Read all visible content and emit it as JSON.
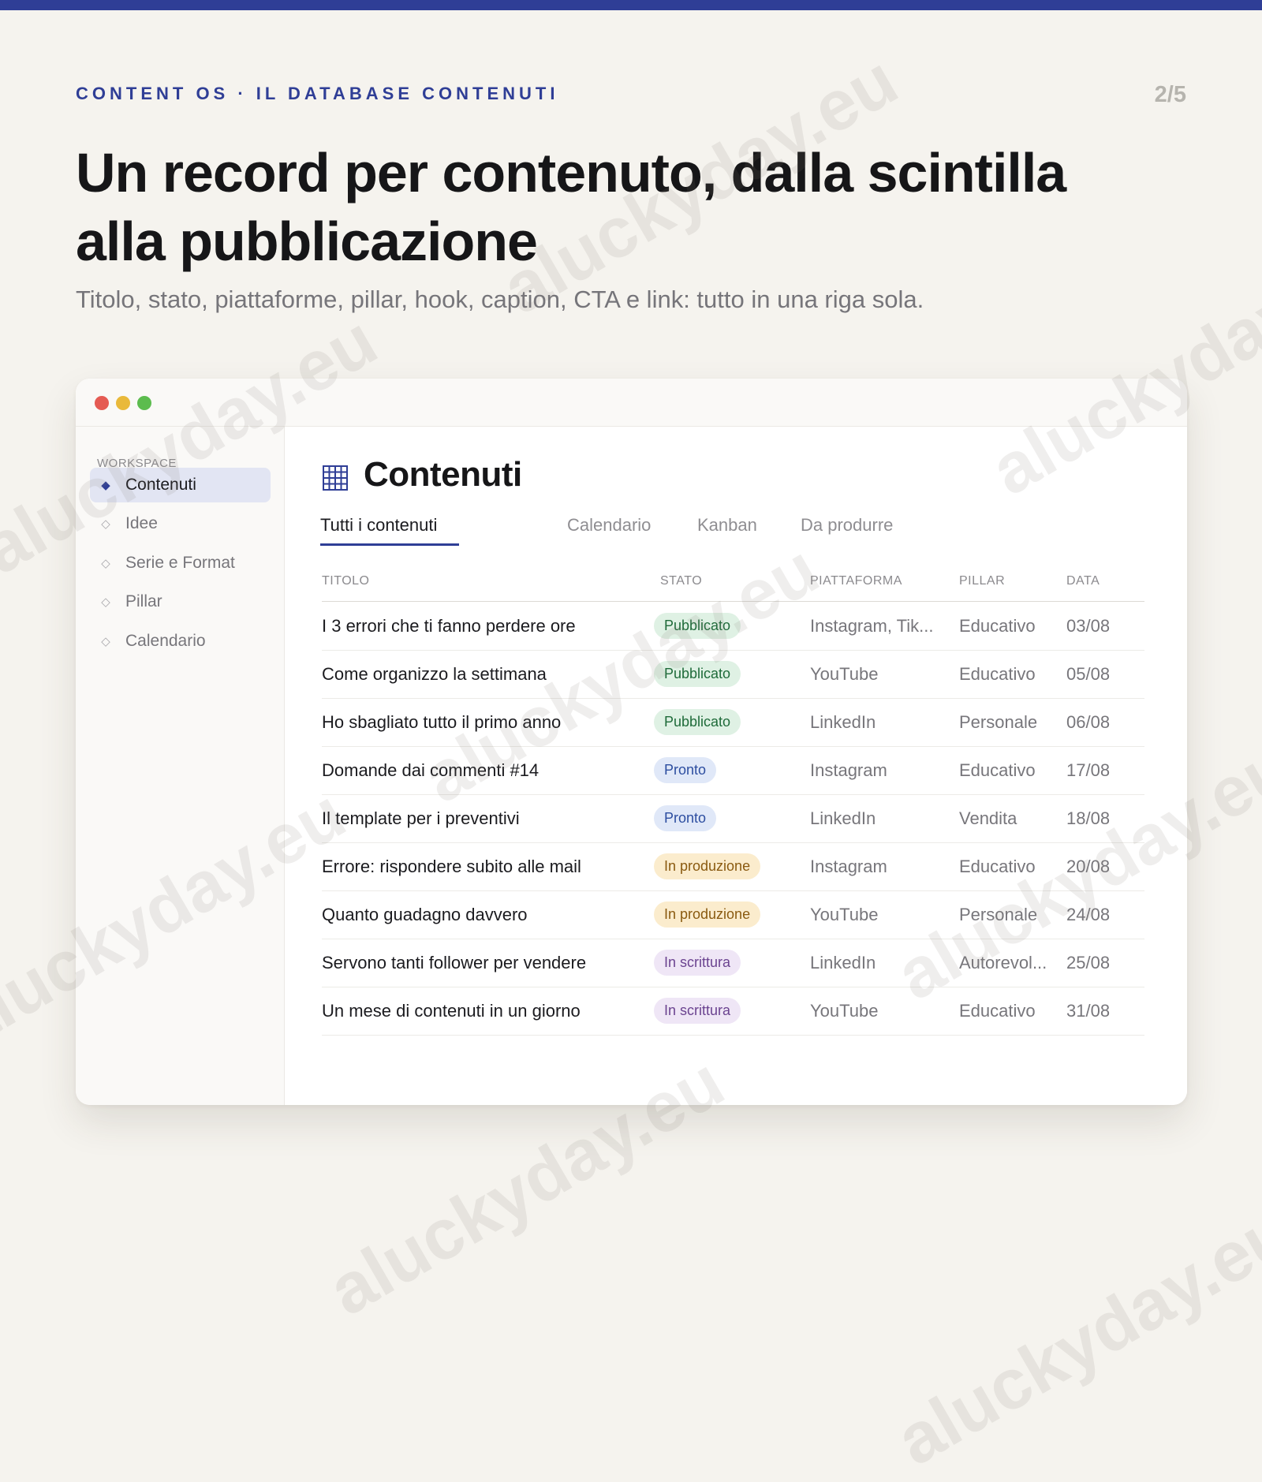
{
  "eyebrow": "CONTENT OS · IL DATABASE CONTENUTI",
  "page_indicator": "2/5",
  "headline": "Un record per contenuto, dalla scintilla alla pubblicazione",
  "subtitle": "Titolo, stato, piattaforme, pillar, hook, caption, CTA e link: tutto in una riga sola.",
  "watermark": "aluckyday.eu",
  "colors": {
    "accent": "#2f3e96",
    "background": "#f5f3ee",
    "status_pubblicato": "#dff1e4",
    "status_pronto": "#e0e8f8",
    "status_in_produzione": "#fbeccd",
    "status_in_scrittura": "#efe6f6"
  },
  "sidebar": {
    "heading": "WORKSPACE",
    "items": [
      {
        "label": "Contenuti",
        "icon": "diamond-filled-icon",
        "active": true
      },
      {
        "label": "Idee",
        "icon": "diamond-outline-icon",
        "active": false
      },
      {
        "label": "Serie e Format",
        "icon": "diamond-outline-icon",
        "active": false
      },
      {
        "label": "Pillar",
        "icon": "diamond-outline-icon",
        "active": false
      },
      {
        "label": "Calendario",
        "icon": "diamond-outline-icon",
        "active": false
      }
    ]
  },
  "database": {
    "icon": "table-grid-icon",
    "title": "Contenuti",
    "tabs": [
      {
        "label": "Tutti i contenuti",
        "active": true
      },
      {
        "label": "Calendario",
        "active": false
      },
      {
        "label": "Kanban",
        "active": false
      },
      {
        "label": "Da produrre",
        "active": false
      }
    ],
    "columns": [
      "TITOLO",
      "STATO",
      "PIATTAFORMA",
      "PILLAR",
      "DATA"
    ],
    "rows": [
      {
        "titolo": "I 3 errori che ti fanno perdere ore",
        "stato": "Pubblicato",
        "piattaforma": "Instagram, Tik...",
        "pillar": "Educativo",
        "data": "03/08"
      },
      {
        "titolo": "Come organizzo la settimana",
        "stato": "Pubblicato",
        "piattaforma": "YouTube",
        "pillar": "Educativo",
        "data": "05/08"
      },
      {
        "titolo": "Ho sbagliato tutto il primo anno",
        "stato": "Pubblicato",
        "piattaforma": "LinkedIn",
        "pillar": "Personale",
        "data": "06/08"
      },
      {
        "titolo": "Domande dai commenti #14",
        "stato": "Pronto",
        "piattaforma": "Instagram",
        "pillar": "Educativo",
        "data": "17/08"
      },
      {
        "titolo": "Il template per i preventivi",
        "stato": "Pronto",
        "piattaforma": "LinkedIn",
        "pillar": "Vendita",
        "data": "18/08"
      },
      {
        "titolo": "Errore: rispondere subito alle mail",
        "stato": "In produzione",
        "piattaforma": "Instagram",
        "pillar": "Educativo",
        "data": "20/08"
      },
      {
        "titolo": "Quanto guadagno davvero",
        "stato": "In produzione",
        "piattaforma": "YouTube",
        "pillar": "Personale",
        "data": "24/08"
      },
      {
        "titolo": "Servono tanti follower per vendere",
        "stato": "In scrittura",
        "piattaforma": "LinkedIn",
        "pillar": "Autorevol...",
        "data": "25/08"
      },
      {
        "titolo": "Un mese di contenuti in un giorno",
        "stato": "In scrittura",
        "piattaforma": "YouTube",
        "pillar": "Educativo",
        "data": "31/08"
      }
    ]
  }
}
